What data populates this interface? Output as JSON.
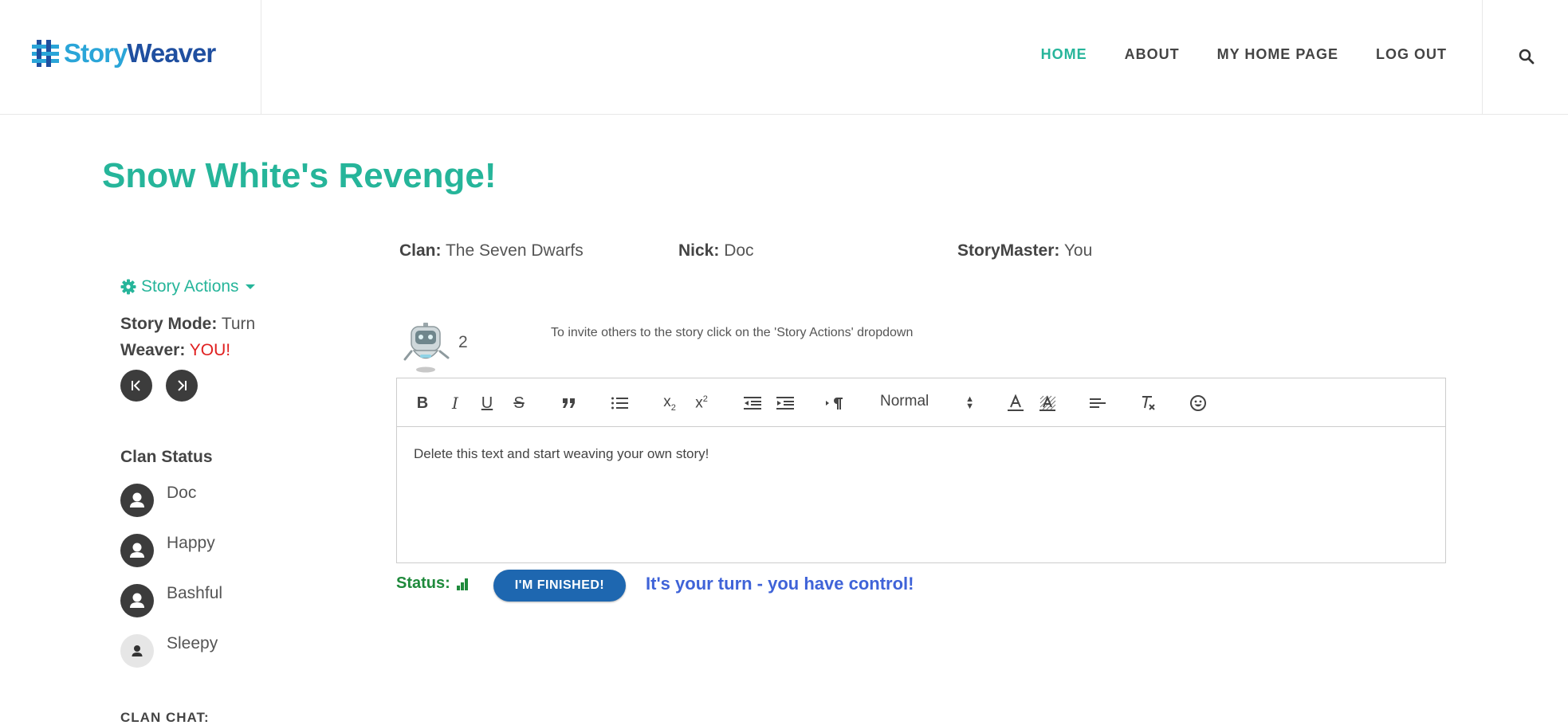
{
  "brand": {
    "part1": "Story",
    "part2": "Weaver"
  },
  "nav": {
    "home": "HOME",
    "about": "ABOUT",
    "my_home_page": "MY HOME PAGE",
    "log_out": "LOG OUT"
  },
  "story": {
    "title": "Snow White's Revenge!"
  },
  "info": {
    "clan_label": "Clan:",
    "clan_value": "The Seven Dwarfs",
    "nick_label": "Nick:",
    "nick_value": "Doc",
    "storymaster_label": "StoryMaster:",
    "storymaster_value": "You"
  },
  "sidebar": {
    "actions_label": "Story Actions",
    "mode_label": "Story Mode:",
    "mode_value": "Turn",
    "weaver_label": "Weaver:",
    "weaver_value": "YOU!",
    "clan_status_heading": "Clan Status",
    "members": [
      {
        "name": "Doc",
        "active": true
      },
      {
        "name": "Happy",
        "active": true
      },
      {
        "name": "Bashful",
        "active": true
      },
      {
        "name": "Sleepy",
        "active": false
      }
    ],
    "clan_chat_heading": "CLAN CHAT:"
  },
  "turn_count": "2",
  "invite_text": "To invite others to the story click on the 'Story Actions' dropdown",
  "editor": {
    "format_value": "Normal",
    "content": "Delete this text and start weaving your own story!"
  },
  "status": {
    "label": "Status:",
    "button": "I'M FINISHED!",
    "message": "It's your turn - you have control!"
  },
  "colors": {
    "accent": "#26b59a",
    "button": "#1e67b0",
    "message": "#3f63d8",
    "status": "#1f8a3c",
    "weaver": "#e02020"
  }
}
